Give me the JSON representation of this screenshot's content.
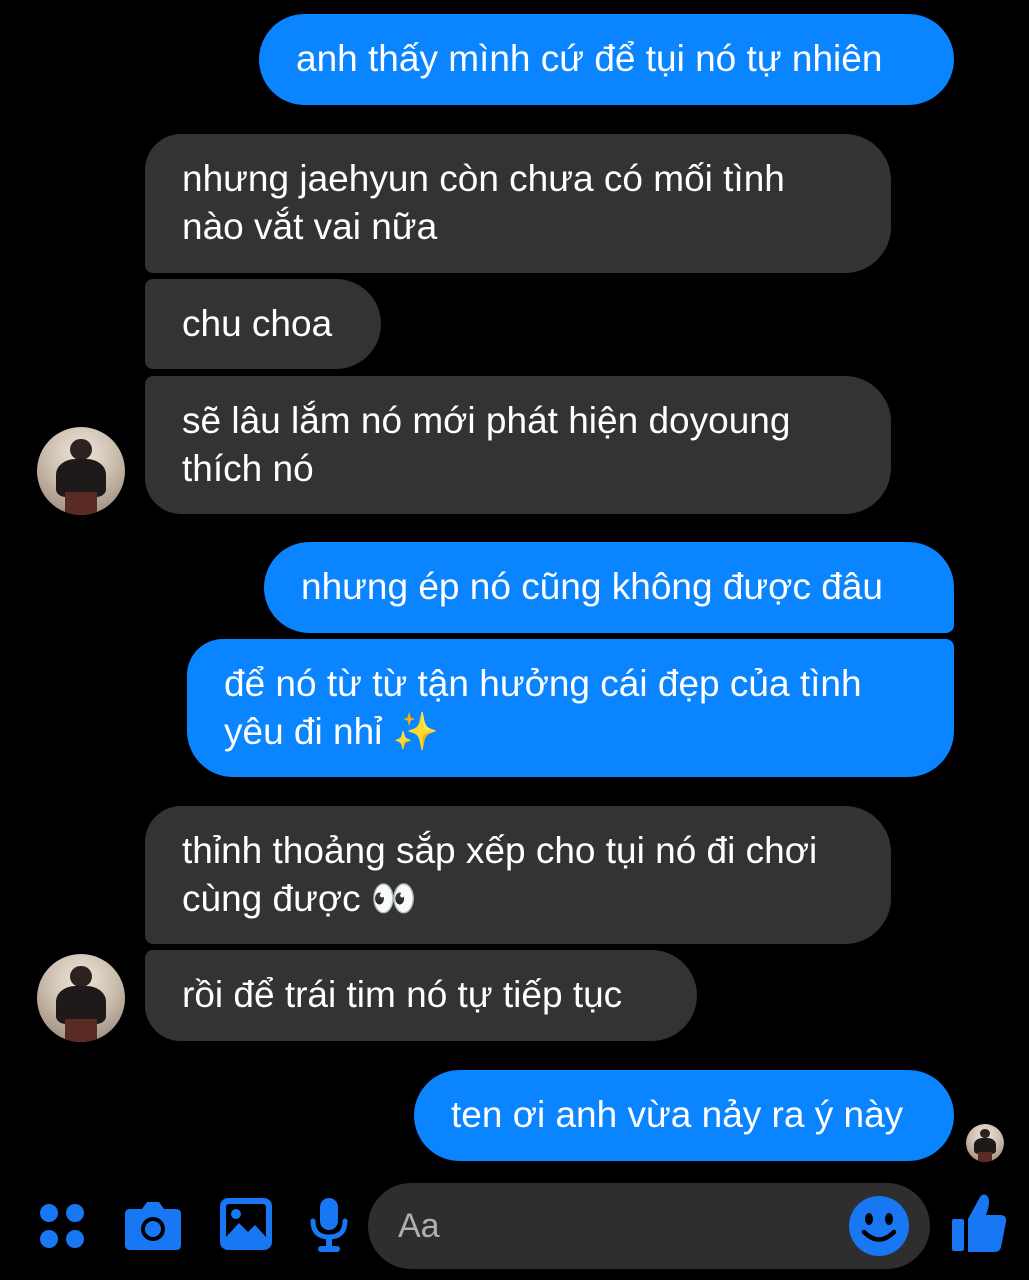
{
  "colors": {
    "sent": "#0a84ff",
    "received": "#333333",
    "background": "#000000",
    "accent": "#1877f2"
  },
  "messages": [
    {
      "from": "me",
      "text": "anh thấy mình cứ để tụi nó tự nhiên"
    },
    {
      "from": "them",
      "text": "nhưng jaehyun còn chưa có mối tình nào vắt vai nữa"
    },
    {
      "from": "them",
      "text": "chu choa"
    },
    {
      "from": "them",
      "text": "sẽ lâu lắm nó mới phát hiện doyoung thích nó"
    },
    {
      "from": "me",
      "text": "nhưng ép nó cũng không được đâu"
    },
    {
      "from": "me",
      "text": "để nó từ từ tận hưởng cái đẹp của tình yêu đi nhỉ ✨"
    },
    {
      "from": "them",
      "text": "thỉnh thoảng sắp xếp cho tụi nó đi chơi cùng được 👀"
    },
    {
      "from": "them",
      "text": "rồi để trái tim nó tự tiếp tục"
    },
    {
      "from": "me",
      "text": "ten ơi anh vừa nảy ra ý này"
    }
  ],
  "composer": {
    "placeholder": "Aa",
    "icons": [
      "menu-dots-icon",
      "camera-icon",
      "gallery-icon",
      "microphone-icon",
      "emoji-icon",
      "thumbs-up-icon"
    ]
  }
}
